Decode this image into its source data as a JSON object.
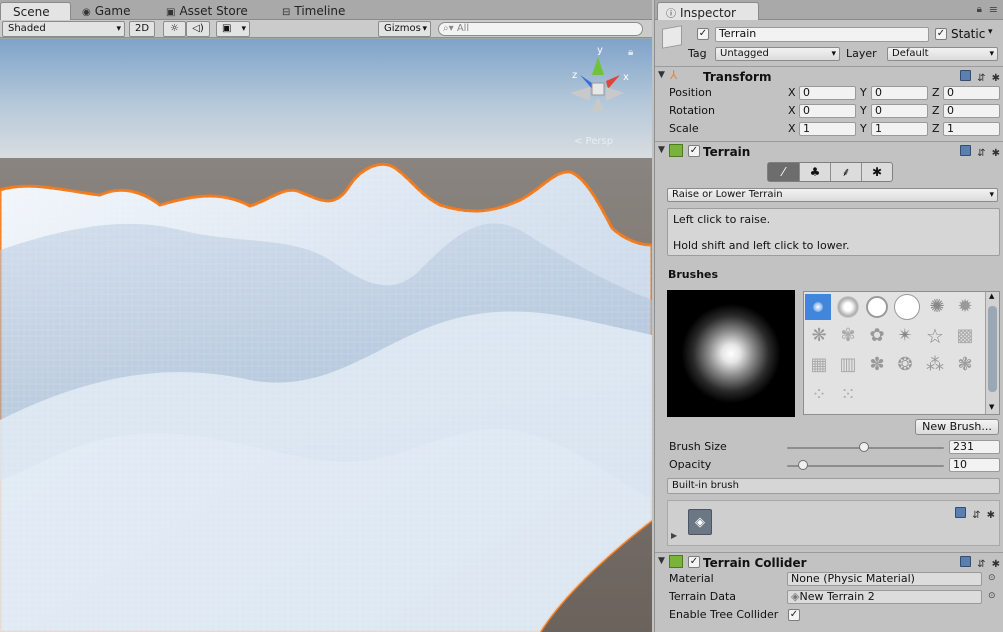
{
  "scene_tabs": [
    {
      "label": "Scene",
      "icon": "scene-icon"
    },
    {
      "label": "Game",
      "icon": "gamepad-icon"
    },
    {
      "label": "Asset Store",
      "icon": "store-icon"
    },
    {
      "label": "Timeline",
      "icon": "timeline-icon"
    }
  ],
  "scene_toolbar": {
    "shading": "Shaded",
    "mode_2d": "2D",
    "gizmos": "Gizmos",
    "search_placeholder": "All"
  },
  "gizmo": {
    "y": "y",
    "x": "x",
    "z": "z",
    "persp": "< Persp"
  },
  "inspector": {
    "tab": "Inspector",
    "object_name": "Terrain",
    "static_label": "Static",
    "static_checked": true,
    "tag_label": "Tag",
    "tag_value": "Untagged",
    "layer_label": "Layer",
    "layer_value": "Default"
  },
  "transform": {
    "title": "Transform",
    "rows": [
      {
        "label": "Position",
        "x": "0",
        "y": "0",
        "z": "0"
      },
      {
        "label": "Rotation",
        "x": "0",
        "y": "0",
        "z": "0"
      },
      {
        "label": "Scale",
        "x": "1",
        "y": "1",
        "z": "1"
      }
    ],
    "axis_x": "X",
    "axis_y": "Y",
    "axis_z": "Z"
  },
  "terrain": {
    "title": "Terrain",
    "tool_icons": [
      "paint-brush-icon",
      "tree-icon",
      "grass-icon",
      "gear-icon"
    ],
    "tool_dropdown": "Raise or Lower Terrain",
    "help_line1": "Left click to raise.",
    "help_line2": "Hold shift and left click to lower.",
    "brushes_label": "Brushes",
    "new_brush_button": "New Brush...",
    "brush_size_label": "Brush Size",
    "brush_size_value": "231",
    "brush_size_fraction": 0.49,
    "opacity_label": "Opacity",
    "opacity_value": "10",
    "opacity_fraction": 0.1,
    "builtin_label": "Built-in brush"
  },
  "terrain_collider": {
    "title": "Terrain Collider",
    "material_label": "Material",
    "material_value": "None (Physic Material)",
    "terrain_data_label": "Terrain Data",
    "terrain_data_value": "New Terrain 2",
    "tree_collider_label": "Enable Tree Collider",
    "tree_collider_checked": true
  },
  "colors": {
    "selection_outline": "#f07a1e",
    "sky_top": "#8fb0cf",
    "ground": "#6f6660",
    "terrain": "#dfe9f4",
    "panel": "#c2c2c2"
  }
}
